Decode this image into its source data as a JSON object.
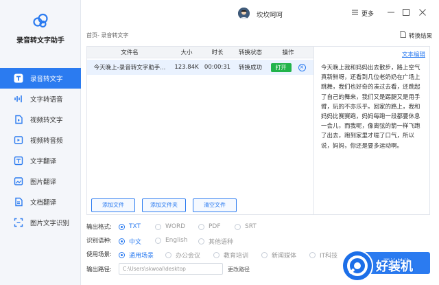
{
  "app": {
    "name": "录音转文字助手"
  },
  "sidebar": {
    "items": [
      {
        "label": "录音转文字",
        "icon": "text-t-icon",
        "active": true
      },
      {
        "label": "文字转语音",
        "icon": "audio-wave-icon",
        "active": false
      },
      {
        "label": "视频转文字",
        "icon": "video-text-icon",
        "active": false
      },
      {
        "label": "视频转音频",
        "icon": "video-audio-icon",
        "active": false
      },
      {
        "label": "文字翻译",
        "icon": "translate-icon",
        "active": false
      },
      {
        "label": "图片翻译",
        "icon": "image-translate-icon",
        "active": false
      },
      {
        "label": "文档翻译",
        "icon": "document-translate-icon",
        "active": false
      },
      {
        "label": "图片文字识别",
        "icon": "image-ocr-icon",
        "active": false
      }
    ]
  },
  "header": {
    "username": "坎坎呵呵",
    "more_label": "更多"
  },
  "breadcrumb": "首页- 录音转文字",
  "convert_result_label": "转换结果",
  "table": {
    "headers": [
      "文件名",
      "大小",
      "时长",
      "转换状态",
      "操作"
    ],
    "rows": [
      {
        "name": "今天晚上-录音转文字助手...",
        "size": "123.84K",
        "duration": "00:00:31",
        "status": "转换成功",
        "action": "打开"
      }
    ]
  },
  "panel_buttons": {
    "add_file": "添加文件",
    "add_folder": "添加文件夹",
    "clear_files": "清空文件"
  },
  "text_panel": {
    "edit_label": "文本编辑",
    "content": "今天晚上我和妈妈出去散步，路上空气真新鲜呀，还看到几位老奶奶在广场上跳舞，我们也好奇的凑过去看，还跳起了自己的舞来，我们又是踢腿又是用手臂，玩的不亦乐乎。回家的路上，我和妈妈比赛赛跑，妈妈每跑一段都要休息一会儿，而我呢，像离弦的箭一样飞跑了出去，跑到家里才喘了口气，所以说，妈妈，你还是要多运动啊。"
  },
  "options": {
    "output_format": {
      "label": "输出格式:",
      "choices": [
        "TXT",
        "WORD",
        "PDF",
        "SRT"
      ],
      "selected": "TXT"
    },
    "language": {
      "label": "识别语种:",
      "choices": [
        "中文",
        "English",
        "其他语种"
      ],
      "selected": "中文"
    },
    "scene": {
      "label": "使用场景:",
      "choices": [
        "通用场景",
        "办公会议",
        "教育培训",
        "新闻媒体",
        "IT科技"
      ],
      "selected": "通用场景"
    },
    "output_path": {
      "label": "输出路径:",
      "value": "C:\\Users\\skwoal\\desktop",
      "change_label": "更改路径"
    }
  },
  "start_button": "开始转换",
  "watermark": "好装机",
  "colors": {
    "accent": "#2b7bf0",
    "success": "#21b34b",
    "sidebar_bg": "#f4f6fa"
  }
}
